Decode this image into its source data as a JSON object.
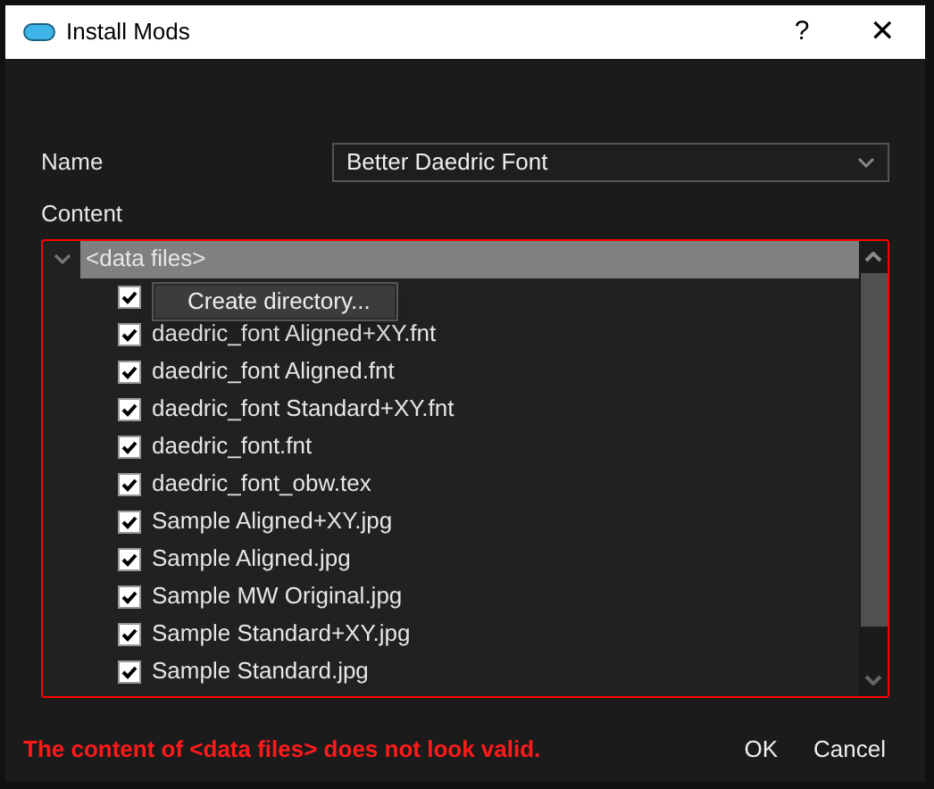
{
  "window": {
    "title": "Install Mods",
    "buttons": [
      "?",
      "✕"
    ]
  },
  "name_field": {
    "label": "Name",
    "value": "Better Daedric Font"
  },
  "content": {
    "label": "Content",
    "tree": [
      {
        "name": "<data files>",
        "expanded": true,
        "selected": true,
        "children": [
          {
            "checked": true
          },
          {
            "name": "daedric_font Aligned+XY.fnt",
            "checked": true
          },
          {
            "name": "daedric_font Aligned.fnt",
            "checked": true
          },
          {
            "name": "daedric_font Standard+XY.fnt",
            "checked": true
          },
          {
            "name": "daedric_font.fnt",
            "checked": true
          },
          {
            "name": "daedric_font_obw.tex",
            "checked": true
          },
          {
            "name": "Sample Aligned+XY.jpg",
            "checked": true
          },
          {
            "name": "Sample Aligned.jpg",
            "checked": true
          },
          {
            "name": "Sample MW Original.jpg",
            "checked": true
          },
          {
            "name": "Sample Standard+XY.jpg",
            "checked": true
          },
          {
            "name": "Sample Standard.jpg",
            "checked": true
          }
        ]
      }
    ]
  },
  "context_menu": {
    "items": [
      "Create directory..."
    ]
  },
  "error": "The content of <data files> does not look valid.",
  "buttons": [
    "OK",
    "Cancel"
  ]
}
